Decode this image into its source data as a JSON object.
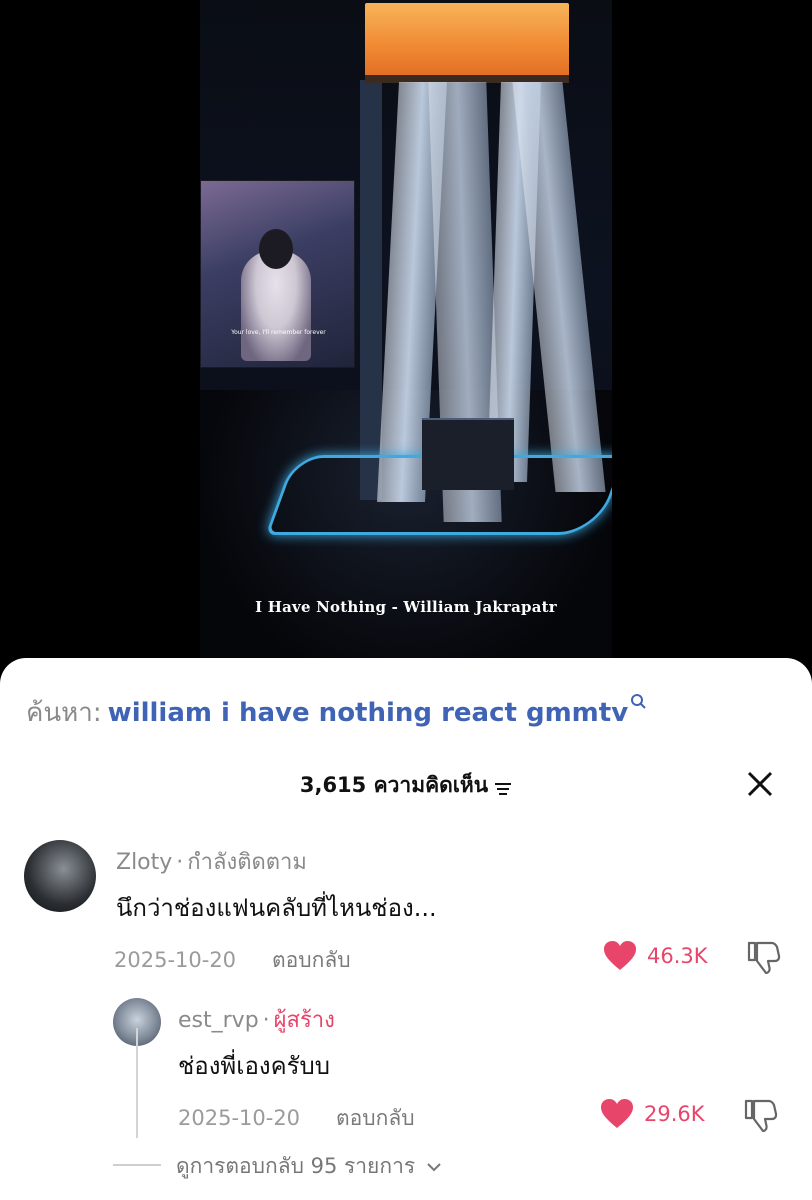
{
  "video": {
    "caption": "I Have Nothing - William Jakrapatr",
    "screen_subtitle": "Your love, I'll remember forever"
  },
  "search": {
    "prefix": "ค้นหา:",
    "query": "william i have nothing react gmmtv",
    "icon": "search-icon"
  },
  "comments_header": {
    "count_label": "3,615 ความคิดเห็น",
    "sort_icon": "sort-icon",
    "close_icon": "close-icon"
  },
  "comments": [
    {
      "username": "Zloty",
      "tag": "กำลังติดตาม",
      "text": "นึกว่าช่องแฟนคลับที่ไหนช่อง...",
      "date": "2025-10-20",
      "reply_label": "ตอบกลับ",
      "likes": "46.3K",
      "replies": [
        {
          "username": "est_rvp",
          "tag": "ผู้สร้าง",
          "text": "ช่องพี่เองครับบ",
          "date": "2025-10-20",
          "reply_label": "ตอบกลับ",
          "likes": "29.6K"
        }
      ],
      "view_replies_label": "ดูการตอบกลับ 95 รายการ"
    }
  ],
  "colors": {
    "accent_blue": "#3f63b5",
    "like_red": "#e8456a",
    "muted_gray": "#8a8a8a"
  }
}
